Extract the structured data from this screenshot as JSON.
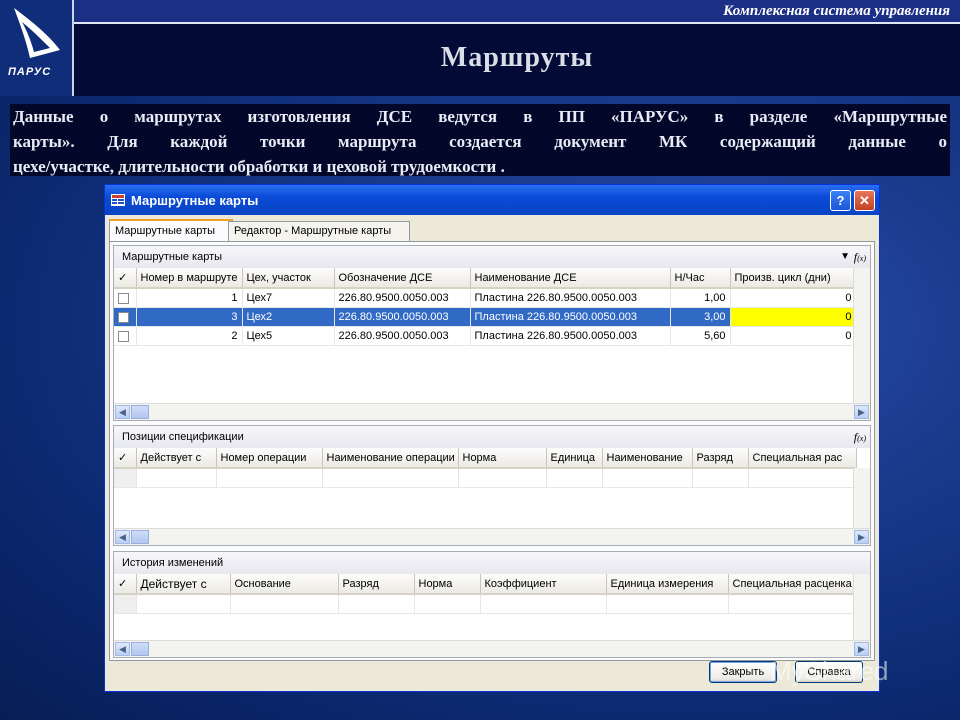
{
  "header": {
    "company": "Комплексная система управления",
    "logo_text": "ПАРУС",
    "title": "Маршруты"
  },
  "description": {
    "line1": "Данные о маршрутах изготовления ДСЕ ведутся в ПП «ПАРУС» в разделе «Маршрутные",
    "line2": "карты». Для каждой точки маршрута создается документ МК содержащий данные о",
    "line3": "цехе/участке, длительности обработки и цеховой трудоемкости ."
  },
  "window": {
    "title": "Маршрутные карты",
    "help_label": "?",
    "close_label": "✕",
    "tabs": [
      "Маршрутные карты",
      "Редактор - Маршрутные карты"
    ],
    "buttons": {
      "close": "Закрыть",
      "help": "Справка"
    }
  },
  "routes": {
    "title": "Маршрутные карты",
    "fx_label": "f",
    "fx_sub": "(x)",
    "columns": [
      "✓",
      "Номер в маршруте",
      "Цех, участок",
      "Обозначение ДСЕ",
      "Наименование ДСЕ",
      "Н/Час",
      "Произв. цикл (дни)"
    ],
    "rows": [
      {
        "num": "1",
        "shop": "Цех7",
        "code": "226.80.9500.0050.003",
        "name": "Пластина 226.80.9500.0050.003",
        "norm": "1,00",
        "cycle": "0"
      },
      {
        "num": "3",
        "shop": "Цех2",
        "code": "226.80.9500.0050.003",
        "name": "Пластина 226.80.9500.0050.003",
        "norm": "3,00",
        "cycle": "0"
      },
      {
        "num": "2",
        "shop": "Цех5",
        "code": "226.80.9500.0050.003",
        "name": "Пластина 226.80.9500.0050.003",
        "norm": "5,60",
        "cycle": "0"
      }
    ]
  },
  "spec": {
    "title": "Позиции спецификации",
    "columns": [
      "✓",
      "Действует с",
      "Номер операции",
      "Наименование операции",
      "Норма",
      "Единица",
      "Наименование",
      "Разряд",
      "Специальная рас"
    ]
  },
  "history": {
    "title": "История изменений",
    "columns": [
      "✓",
      "Действует с",
      "Основание",
      "Разряд",
      "Норма",
      "Коэффициент",
      "Единица измерения",
      "Специальная расценка"
    ]
  },
  "watermark": "MyShared",
  "colors": {
    "selection": "#316ac5",
    "highlight": "#ffff00",
    "titlebar": "#0a4ad6"
  }
}
